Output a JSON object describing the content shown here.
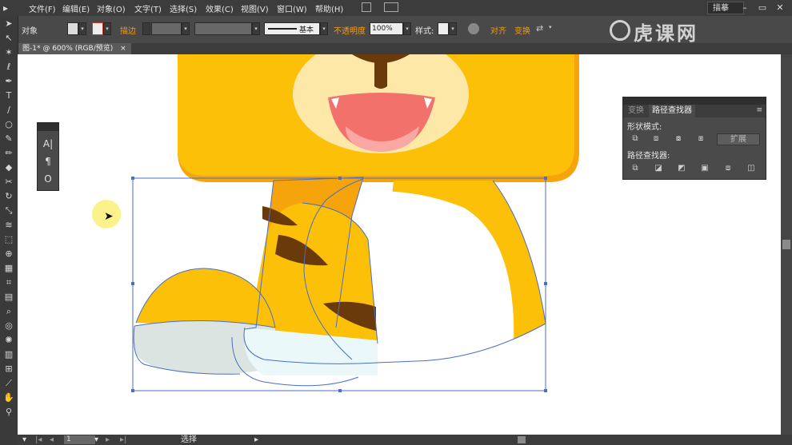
{
  "menubar": {
    "items": [
      "文件(F)",
      "编辑(E)",
      "对象(O)",
      "文字(T)",
      "选择(S)",
      "效果(C)",
      "视图(V)",
      "窗口(W)",
      "帮助(H)"
    ],
    "workspace_label": "描摹"
  },
  "controlbar": {
    "object_label": "对象",
    "stroke_label": "描边",
    "stroke_style": "基本",
    "opacity_label": "不透明度",
    "opacity_value": "100%",
    "style_label": "样式:",
    "align_label": "对齐",
    "transform_label": "变换"
  },
  "document_tab": {
    "title": "图-1* @ 600% (RGB/预览)",
    "close": "×"
  },
  "tools": [
    "select-tool-icon",
    "direct-select-tool-icon",
    "magic-wand-icon",
    "lasso-icon",
    "pen-tool-icon",
    "type-tool-icon",
    "line-tool-icon",
    "ellipse-tool-icon",
    "paintbrush-icon",
    "pencil-icon",
    "blob-brush-icon",
    "eraser-icon",
    "rotate-icon",
    "scale-icon",
    "warp-icon",
    "free-transform-icon",
    "shape-builder-icon",
    "perspective-grid-icon",
    "mesh-icon",
    "gradient-icon",
    "eyedropper-icon",
    "blend-icon",
    "symbol-sprayer-icon",
    "column-graph-icon",
    "artboard-icon",
    "slice-icon",
    "hand-icon",
    "zoom-icon"
  ],
  "float_panel": {
    "buttons": [
      "A|",
      "¶",
      "O"
    ]
  },
  "pathfinder": {
    "tab_transform": "变换",
    "tab_pathfinder": "路径查找器",
    "shape_modes_label": "形状模式:",
    "expand_label": "扩展",
    "pathfinders_label": "路径查找器:"
  },
  "statusbar": {
    "page": "1",
    "tool_name": "选择"
  },
  "watermark": {
    "text": "虎课网"
  },
  "colors": {
    "tiger_yellow": "#FDC009",
    "tiger_orange": "#F5A40C",
    "stripe_brown": "#6B3A0A",
    "shoe_gray": "#DCE4E2",
    "selection_blue": "#4A6FC4"
  }
}
